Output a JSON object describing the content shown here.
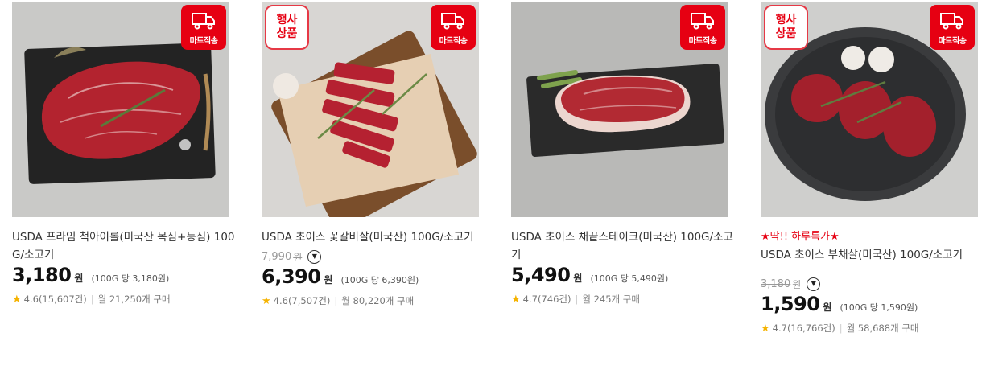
{
  "colors": {
    "accent": "#e60012",
    "star": "#f5b301"
  },
  "products": [
    {
      "promo": "",
      "title": "USDA 프라임 척아이롤(미국산 목심+등심) 100G/소고기",
      "has_event_badge": false,
      "original_price": "",
      "original_unit": "",
      "price": "3,180",
      "currency": "원",
      "unit_price": "(100G 당 3,180원)",
      "rating": "4.6(15,607건)",
      "purchases": "월 21,250개 구매",
      "ship_label": "마트직송"
    },
    {
      "promo": "",
      "title": "USDA 초이스 꽃갈비살(미국산) 100G/소고기",
      "has_event_badge": true,
      "event_badge": "행사\n상품",
      "original_price": "7,990",
      "original_unit": "원",
      "price": "6,390",
      "currency": "원",
      "unit_price": "(100G 당 6,390원)",
      "rating": "4.6(7,507건)",
      "purchases": "월 80,220개 구매",
      "ship_label": "마트직송"
    },
    {
      "promo": "",
      "title": "USDA 초이스 채끝스테이크(미국산) 100G/소고기",
      "has_event_badge": false,
      "original_price": "",
      "original_unit": "",
      "price": "5,490",
      "currency": "원",
      "unit_price": "(100G 당 5,490원)",
      "rating": "4.7(746건)",
      "purchases": "월 245개 구매",
      "ship_label": "마트직송"
    },
    {
      "promo": "★딱!! 하루특가★",
      "title": "USDA 초이스 부채살(미국산) 100G/소고기",
      "has_event_badge": true,
      "event_badge": "행사\n상품",
      "original_price": "3,180",
      "original_unit": "원",
      "price": "1,590",
      "currency": "원",
      "unit_price": "(100G 당 1,590원)",
      "rating": "4.7(16,766건)",
      "purchases": "월 58,688개 구매",
      "ship_label": "마트직송"
    }
  ],
  "icons": {
    "ship": "delivery-truck-icon",
    "star": "star-icon",
    "dropdown": "chevron-down-circle-icon"
  }
}
